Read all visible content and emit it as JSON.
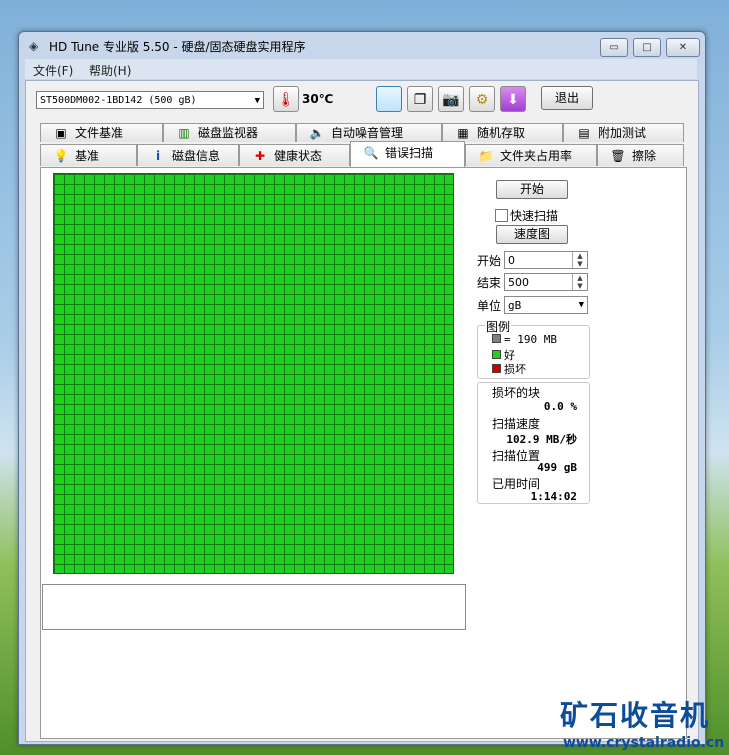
{
  "window": {
    "title": "HD Tune 专业版 5.50 - 硬盘/固态硬盘实用程序",
    "min_glyph": "▭",
    "max_glyph": "□",
    "close_glyph": "✕"
  },
  "menu": [
    "文件(F)",
    "帮助(H)"
  ],
  "toolbar": {
    "drive": "ST500DM002-1BD142 (500 gB)",
    "temperature": "30℃",
    "exit_label": "退出"
  },
  "tabs_top": [
    {
      "label": "文件基准",
      "icon": "file-benchmark-icon"
    },
    {
      "label": "磁盘监视器",
      "icon": "disk-monitor-icon"
    },
    {
      "label": "自动噪音管理",
      "icon": "speaker-icon"
    },
    {
      "label": "随机存取",
      "icon": "random-access-icon"
    },
    {
      "label": "附加测试",
      "icon": "extra-tests-icon"
    }
  ],
  "tabs_bottom": [
    {
      "label": "基准",
      "icon": "bulb-icon"
    },
    {
      "label": "磁盘信息",
      "icon": "info-icon"
    },
    {
      "label": "健康状态",
      "icon": "health-cross-icon"
    },
    {
      "label": "错误扫描",
      "icon": "magnifier-icon",
      "active": true
    },
    {
      "label": "文件夹占用率",
      "icon": "folder-icon"
    },
    {
      "label": "擦除",
      "icon": "trash-icon"
    }
  ],
  "scan": {
    "start_button": "开始",
    "quick_scan_label": "快速扫描",
    "quick_scan_checked": false,
    "speed_map_button": "速度图",
    "start_label": "开始",
    "start_value": "0",
    "end_label": "结束",
    "end_value": "500",
    "unit_label": "单位",
    "unit_value": "gB",
    "legend_title": "图例",
    "legend_block": "= 190 MB",
    "legend_good": "好",
    "legend_bad": "损坏",
    "damaged_blocks_label": "损坏的块",
    "damaged_blocks_value": "0.0 %",
    "scan_speed_label": "扫描速度",
    "scan_speed_value": "102.9 MB/秒",
    "scan_position_label": "扫描位置",
    "scan_position_value": "499 gB",
    "elapsed_label": "已用时间",
    "elapsed_value": "1:14:02",
    "blocks_good_fraction": 1.0
  },
  "colors": {
    "good": "#1fd11f",
    "bad": "#cc0000",
    "block": "#808080"
  },
  "watermark": {
    "logo_text": "矿石收音机",
    "url": "www.crystalradio.cn"
  }
}
